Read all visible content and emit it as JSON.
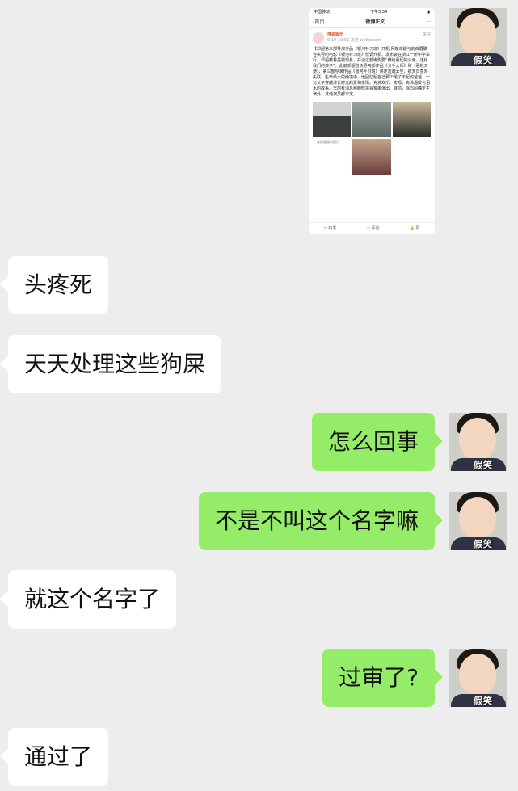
{
  "screenshot": {
    "status_carrier": "中国移动",
    "status_time": "下午3:54",
    "nav_back": "首页",
    "nav_title": "微博正文",
    "nav_more": "···",
    "account_name": "搜狐娱乐",
    "post_meta": "9-10 19:50 来自 weibo.com",
    "follow_badge": "关注",
    "post_text": "【邓超第三部导演作品《银河补习班》开机 网曝邓超与俞白眉联合执导的电影《银河补习班》低调开机。发布会在浙江一所中学举行，邓超戴着墨镜现身，并谈这部电影要“献给我们的父亲，送给我们的孩子”。此前邓超曾执导两部作品《分手大师》和《恶棍天使》，第三部导演作品《银河补习班》讲述浩瀚太空，航天员意外失联，生命最大的绝境中，他回忆起自己那个最了不起的爸爸，一对父子穿越漫长时光的爱和亲情。充满欢乐、奇观，充满温暖与泪水的故事。早前有消息称鹿晗将会客串演出。目前，除邓超确定主演外，其他演员都未定。",
    "photo_caption": "@搜狐娱乐图片",
    "action_repost": "转发",
    "action_comment": "评论",
    "action_like": "赞"
  },
  "messages": [
    {
      "side": "left",
      "text": "头疼死"
    },
    {
      "side": "left",
      "text": "天天处理这些狗屎"
    },
    {
      "side": "right",
      "text": "怎么回事"
    },
    {
      "side": "right",
      "text": "不是不叫这个名字嘛"
    },
    {
      "side": "left",
      "text": "就这个名字了"
    },
    {
      "side": "right",
      "text": "过审了?"
    },
    {
      "side": "left",
      "text": "通过了"
    }
  ],
  "avatar_label": "假笑",
  "colors": {
    "background": "#ededed",
    "sent_bubble": "#95ec69",
    "received_bubble": "#ffffff"
  }
}
